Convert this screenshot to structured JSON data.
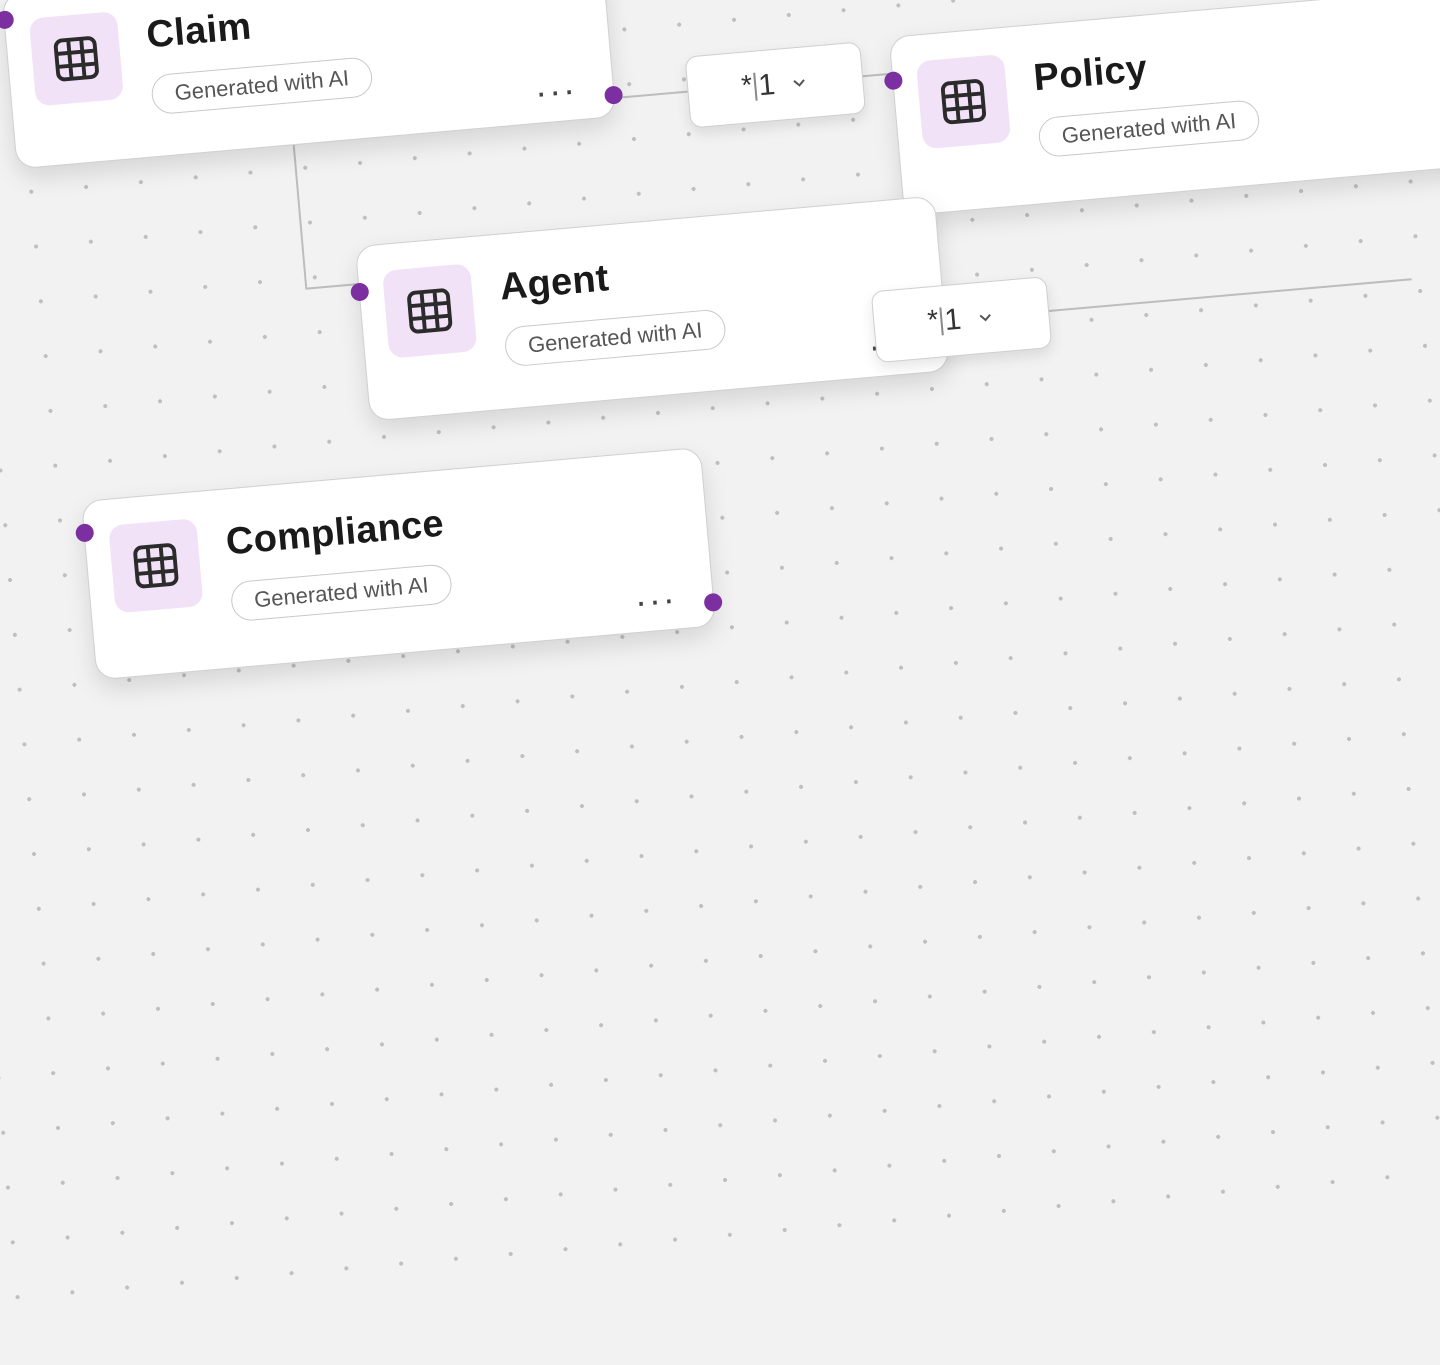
{
  "badges": {
    "ai": "Generated with AI"
  },
  "cards": {
    "claim": {
      "title": "Claim"
    },
    "policy": {
      "title": "Policy"
    },
    "agent": {
      "title": "Agent"
    },
    "compliance": {
      "title": "Compliance"
    }
  },
  "relations": {
    "claim_policy": {
      "left": "*",
      "right": "1"
    },
    "agent_policy": {
      "left": "*",
      "right": "1"
    }
  },
  "colors": {
    "accent": "#7b2fa0",
    "tileBg": "#f2e2f7"
  }
}
